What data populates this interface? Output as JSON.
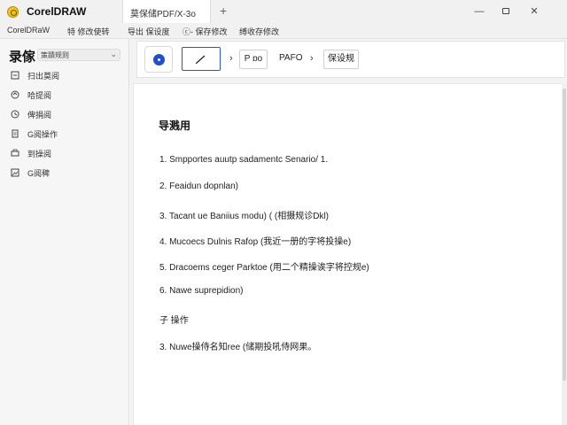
{
  "titlebar": {
    "app_title": "CorelDRAW",
    "tab_label": "莫保储PDF/X-3o",
    "add_tab": "+",
    "minimize": "—",
    "close": "✕"
  },
  "menu": {
    "items": [
      "CorelDRaW",
      "特 修改使转",
      "导出 保设度",
      "ⓒ- 保存修改",
      "缚收存修改"
    ]
  },
  "sidebar": {
    "title": "录傢",
    "select_label": "策蹟规则",
    "items": [
      {
        "icon": "select-tool-icon",
        "label": "扫出莫阅"
      },
      {
        "icon": "export-icon",
        "label": "哈提阅"
      },
      {
        "icon": "history-icon",
        "label": "俾捐阅"
      },
      {
        "icon": "document-icon",
        "label": "G阅操作"
      },
      {
        "icon": "print-icon",
        "label": "到操阅"
      },
      {
        "icon": "image-icon",
        "label": "G阅稗"
      }
    ]
  },
  "toolbar": {
    "pen_label": "",
    "arrow": "›",
    "pdf_label": "P ɒo",
    "pdf_text": "PAFO",
    "save_label": "保设规"
  },
  "document": {
    "heading": "导溅用",
    "lines": [
      "1.   Smpportes auutp sadamentc Senario/ 1.",
      "2.   Feaidun   dopnlan)",
      "3.   Tacant ue Baniius modu) ( (相摄规诊Dkl)",
      "4.   Mucoecs Dulnis  Rafop  (我近一册的字将投操e)",
      "5.   Dracoems ceger  Parktoe  (用二个精操诶字将控规e)",
      "6.   Nawe suprepidion)",
      "子 操作",
      "3.   Nuwe操侍名知ree    (储期投吼侍网果。"
    ]
  },
  "colors": {
    "accent": "#2b56c9",
    "logo": "#f3c614"
  }
}
